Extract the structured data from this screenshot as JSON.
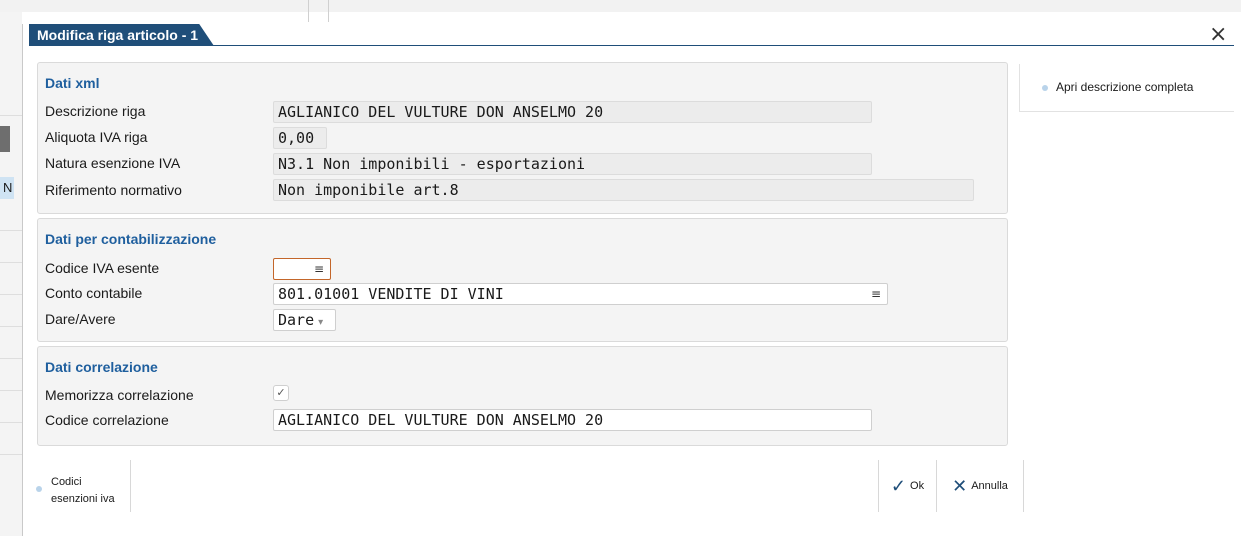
{
  "background": {
    "selected_letter": "N"
  },
  "dialog": {
    "title": "Modifica riga articolo - 1",
    "close_icon": "×"
  },
  "dati_xml": {
    "title": "Dati xml",
    "descrizione_riga": {
      "label": "Descrizione riga",
      "value": "AGLIANICO DEL VULTURE DON ANSELMO 20"
    },
    "aliquota_iva": {
      "label": "Aliquota IVA riga",
      "value": "0,00"
    },
    "natura_esenzione": {
      "label": "Natura esenzione IVA",
      "value": "N3.1 Non imponibili - esportazioni"
    },
    "riferimento_normativo": {
      "label": "Riferimento normativo",
      "value": "Non imponibile art.8"
    }
  },
  "dati_contabilizzazione": {
    "title": "Dati per contabilizzazione",
    "codice_iva_esente": {
      "label": "Codice IVA esente",
      "value": ""
    },
    "conto_contabile": {
      "label": "Conto contabile",
      "value": "801.01001 VENDITE DI VINI"
    },
    "dare_avere": {
      "label": "Dare/Avere",
      "value": "Dare"
    }
  },
  "dati_correlazione": {
    "title": "Dati correlazione",
    "memorizza": {
      "label": "Memorizza correlazione",
      "checked": true
    },
    "codice_correlazione": {
      "label": "Codice correlazione",
      "value": "AGLIANICO DEL VULTURE DON ANSELMO 20"
    }
  },
  "side_panel": {
    "apri_descrizione": "Apri descrizione completa"
  },
  "bottom": {
    "codici_esenzioni_line1": "Codici",
    "codici_esenzioni_line2": "esenzioni iva",
    "ok_label": "Ok",
    "annulla_label": "Annulla"
  },
  "colors": {
    "title_bar": "#1f4e79",
    "section_title": "#1f5f9e",
    "focus_border": "#c3662a"
  }
}
